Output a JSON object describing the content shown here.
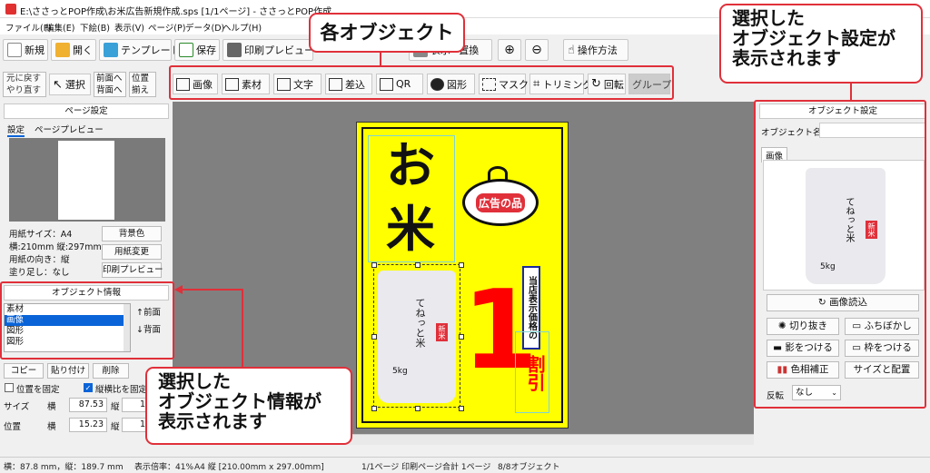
{
  "window": {
    "title": "E:\\ささっとPOP作成\\お米広告新規作成.sps [1/1ページ] - ささっとPOP作成"
  },
  "menu": [
    "ファイル(F)",
    "編集(E)",
    "下絵(B)",
    "表示(V)",
    "ページ(P)",
    "データ(D)",
    "ヘルプ(H)"
  ],
  "toolbar": {
    "new": "新規",
    "open": "開く",
    "template": "テンプレート",
    "save": "保存",
    "print_preview": "印刷プレビュー",
    "data_label": "データ",
    "insert_replace": "表示→置換",
    "howto": "操作方法",
    "undo": "元に戻す",
    "redo": "やり直す",
    "select": "選択",
    "front": "前面へ",
    "back": "背面へ",
    "position": "位置",
    "align": "揃え"
  },
  "object_tools": [
    "画像",
    "素材",
    "文字",
    "差込",
    "QR",
    "図形",
    "マスク",
    "トリミング",
    "回転",
    "グループ"
  ],
  "left": {
    "page_settings_title": "ページ設定",
    "tab_settings": "設定",
    "tab_preview": "ページプレビュー",
    "paper_size": "用紙サイズ：A4",
    "dims": "横:210mm 縦:297mm",
    "orientation": "用紙の向き：縦",
    "bleed": "塗り足し：なし",
    "bg_color": "背景色",
    "change_paper": "用紙変更",
    "print_preview": "印刷プレビュー",
    "obj_info_title": "オブジェクト情報",
    "obj_list": [
      "素材",
      "画像",
      "図形",
      "図形"
    ],
    "selected_index": 1,
    "front_btn": "↑前面",
    "back_btn": "↓背面",
    "copy": "コピー",
    "paste": "貼り付け",
    "delete": "削除",
    "fix_position": "位置を固定",
    "keep_ratio": "縦横比を固定",
    "size_label": "サイズ",
    "pos_label": "位置",
    "horiz": "横",
    "vert": "縦",
    "size_w": "87.53",
    "size_h": "1",
    "pos_x": "15.23",
    "pos_y": "1"
  },
  "poster": {
    "title_top": "お",
    "title_bottom": "米",
    "badge": "広告の品",
    "big_number": "1",
    "vertical_label": "当店表示価格の",
    "discount": "割引",
    "bag_text": "てねっと米",
    "bag_label": "新米",
    "bag_weight": "5kg"
  },
  "right": {
    "title": "オブジェクト設定",
    "name_label": "オブジェクト名",
    "tab_image": "画像",
    "load_image": "画像読込",
    "crop": "切り抜き",
    "blur_edge": "ふちぼかし",
    "shadow": "影をつける",
    "frame": "枠をつける",
    "color_adjust": "色相補正",
    "size_position": "サイズと配置",
    "flip_label": "反転",
    "flip_value": "なし"
  },
  "status": {
    "size": "横：87.8 mm，縦：189.7 mm",
    "zoom": "表示倍率：41%",
    "paper": "A4 縦 [210.00mm x 297.00mm]",
    "pages": "1/1ページ 印刷ページ合計 1ページ",
    "objects": "8/8オブジェクト"
  },
  "callouts": {
    "objects": "各オブジェクト",
    "obj_setting": "選択した\nオブジェクト設定が\n表示されます",
    "obj_info": "選択した\nオブジェクト情報が\n表示されます"
  },
  "colors": {
    "accent": "#e0303a",
    "poster_bg": "#ffff00",
    "discount_red": "#ff0000",
    "selection": "#0a64d8"
  }
}
